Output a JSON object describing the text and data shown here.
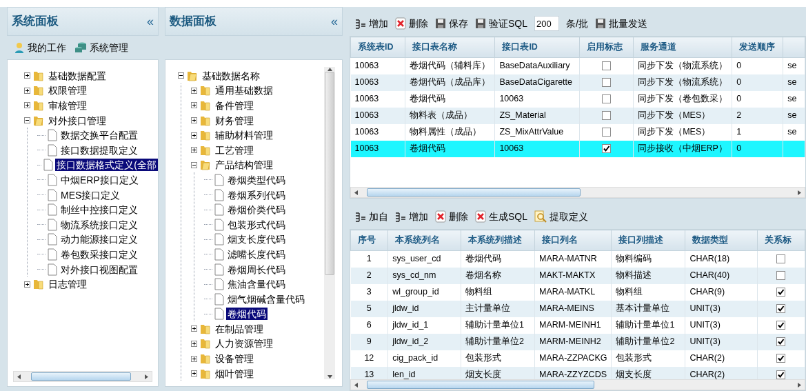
{
  "system_panel": {
    "title": "系统面板",
    "collapse": "«",
    "shortcuts": [
      {
        "label": "我的工作"
      },
      {
        "label": "系统管理"
      }
    ],
    "tree": [
      {
        "label": "基础数据配置",
        "kind": "folder",
        "expanded": false,
        "selected": false
      },
      {
        "label": "权限管理",
        "kind": "folder",
        "expanded": false,
        "selected": false
      },
      {
        "label": "审核管理",
        "kind": "folder",
        "expanded": false,
        "selected": false
      },
      {
        "label": "对外接口管理",
        "kind": "folder",
        "expanded": true,
        "selected": false,
        "children": [
          {
            "label": "数据交换平台配置",
            "kind": "leaf",
            "selected": false
          },
          {
            "label": "接口数据提取定义",
            "kind": "leaf",
            "selected": false
          },
          {
            "label": "接口数据格式定义(全部",
            "kind": "leaf",
            "selected": true
          },
          {
            "label": "中烟ERP接口定义",
            "kind": "leaf",
            "selected": false
          },
          {
            "label": "MES接口定义",
            "kind": "leaf",
            "selected": false
          },
          {
            "label": "制丝中控接口定义",
            "kind": "leaf",
            "selected": false
          },
          {
            "label": "物流系统接口定义",
            "kind": "leaf",
            "selected": false
          },
          {
            "label": "动力能源接口定义",
            "kind": "leaf",
            "selected": false
          },
          {
            "label": "卷包数采接口定义",
            "kind": "leaf",
            "selected": false
          },
          {
            "label": "对外接口视图配置",
            "kind": "leaf",
            "selected": false
          }
        ]
      },
      {
        "label": "日志管理",
        "kind": "folder",
        "expanded": false,
        "selected": false
      }
    ]
  },
  "data_panel": {
    "title": "数据面板",
    "collapse": "«",
    "tree": [
      {
        "label": "基础数据名称",
        "kind": "folder",
        "expanded": true,
        "selected": false,
        "children": [
          {
            "label": "通用基础数据",
            "kind": "folder",
            "expanded": false,
            "selected": false
          },
          {
            "label": "备件管理",
            "kind": "folder",
            "expanded": false,
            "selected": false
          },
          {
            "label": "财务管理",
            "kind": "folder",
            "expanded": false,
            "selected": false
          },
          {
            "label": "辅助材料管理",
            "kind": "folder",
            "expanded": false,
            "selected": false
          },
          {
            "label": "工艺管理",
            "kind": "folder",
            "expanded": false,
            "selected": false
          },
          {
            "label": "产品结构管理",
            "kind": "folder",
            "expanded": true,
            "selected": false,
            "children": [
              {
                "label": "卷烟类型代码",
                "kind": "leaf",
                "selected": false
              },
              {
                "label": "卷烟系列代码",
                "kind": "leaf",
                "selected": false
              },
              {
                "label": "卷烟价类代码",
                "kind": "leaf",
                "selected": false
              },
              {
                "label": "包装形式代码",
                "kind": "leaf",
                "selected": false
              },
              {
                "label": "烟支长度代码",
                "kind": "leaf",
                "selected": false
              },
              {
                "label": "滤嘴长度代码",
                "kind": "leaf",
                "selected": false
              },
              {
                "label": "卷烟周长代码",
                "kind": "leaf",
                "selected": false
              },
              {
                "label": "焦油含量代码",
                "kind": "leaf",
                "selected": false
              },
              {
                "label": "烟气烟碱含量代码",
                "kind": "leaf",
                "selected": false
              },
              {
                "label": "卷烟代码",
                "kind": "leaf",
                "selected": true
              }
            ]
          },
          {
            "label": "在制品管理",
            "kind": "folder",
            "expanded": false,
            "selected": false
          },
          {
            "label": "人力资源管理",
            "kind": "folder",
            "expanded": false,
            "selected": false
          },
          {
            "label": "设备管理",
            "kind": "folder",
            "expanded": false,
            "selected": false
          },
          {
            "label": "烟叶管理",
            "kind": "folder",
            "expanded": false,
            "selected": false
          }
        ]
      }
    ]
  },
  "interface_toolbar": [
    {
      "kind": "button",
      "label": "增加"
    },
    {
      "kind": "button",
      "label": "删除"
    },
    {
      "kind": "button",
      "label": "保存"
    },
    {
      "kind": "button",
      "label": "验证SQL"
    },
    {
      "kind": "input",
      "value": "200"
    },
    {
      "kind": "text",
      "label": "条/批"
    },
    {
      "kind": "button",
      "label": "批量发送"
    }
  ],
  "interface_table": {
    "columns": [
      {
        "label": "系统表ID",
        "kind": "text"
      },
      {
        "label": "接口表名称",
        "kind": "text"
      },
      {
        "label": "接口表ID",
        "kind": "text"
      },
      {
        "label": "启用标志",
        "kind": "check"
      },
      {
        "label": "服务通道",
        "kind": "text"
      },
      {
        "label": "发送顺序",
        "kind": "text"
      },
      {
        "kind": "text"
      }
    ],
    "rows": [
      {
        "selected": false,
        "cells": [
          "10063",
          "卷烟代码（辅料库）",
          "BaseDataAuxiliary",
          false,
          "同步下发（物流系统）",
          "0",
          "se"
        ]
      },
      {
        "selected": false,
        "cells": [
          "10063",
          "卷烟代码（成品库）",
          "BaseDataCigarette",
          false,
          "同步下发（物流系统）",
          "0",
          "se"
        ]
      },
      {
        "selected": false,
        "cells": [
          "10063",
          "卷烟代码",
          "10063",
          false,
          "同步下发（卷包数采）",
          "0",
          "se"
        ]
      },
      {
        "selected": false,
        "cells": [
          "10063",
          "物料表（成品）",
          "ZS_Material",
          false,
          "同步下发（MES）",
          "2",
          "se"
        ]
      },
      {
        "selected": false,
        "cells": [
          "10063",
          "物料属性（成品）",
          "ZS_MixAttrValue",
          false,
          "同步下发（MES）",
          "1",
          "se"
        ]
      },
      {
        "selected": true,
        "cells": [
          "10063",
          "卷烟代码",
          "10063",
          true,
          "同步接收（中烟ERP）",
          "0",
          ""
        ]
      }
    ]
  },
  "column_toolbar": [
    {
      "kind": "button",
      "label": "加自"
    },
    {
      "kind": "button",
      "label": "增加"
    },
    {
      "kind": "button",
      "label": "删除"
    },
    {
      "kind": "button",
      "label": "生成SQL"
    },
    {
      "kind": "button",
      "label": "提取定义"
    }
  ],
  "column_table": {
    "columns": [
      {
        "label": "序号",
        "kind": "center"
      },
      {
        "label": "本系统列名",
        "kind": "text"
      },
      {
        "label": "本系统列描述",
        "kind": "text"
      },
      {
        "label": "接口列名",
        "kind": "text"
      },
      {
        "label": "接口列描述",
        "kind": "text"
      },
      {
        "label": "数据类型",
        "kind": "text"
      },
      {
        "label": "关系标",
        "kind": "check"
      }
    ],
    "rows": [
      {
        "selected": false,
        "cells": [
          "1",
          "sys_user_cd",
          "卷烟代码",
          "MARA-MATNR",
          "物料编码",
          "CHAR(18)",
          false
        ]
      },
      {
        "selected": false,
        "cells": [
          "2",
          "sys_cd_nm",
          "卷烟名称",
          "MAKT-MAKTX",
          "物料描述",
          "CHAR(40)",
          false
        ]
      },
      {
        "selected": false,
        "cells": [
          "3",
          "wl_group_id",
          "物料组",
          "MARA-MATKL",
          "物料组",
          "CHAR(9)",
          true
        ]
      },
      {
        "selected": false,
        "cells": [
          "5",
          "jldw_id",
          "主计量单位",
          "MARA-MEINS",
          "基本计量单位",
          "UNIT(3)",
          true
        ]
      },
      {
        "selected": false,
        "cells": [
          "6",
          "jldw_id_1",
          "辅助计量单位1",
          "MARM-MEINH1",
          "辅助计量单位1",
          "UNIT(3)",
          true
        ]
      },
      {
        "selected": false,
        "cells": [
          "9",
          "jldw_id_2",
          "辅助计量单位2",
          "MARM-MEINH2",
          "辅助计量单位2",
          "UNIT(3)",
          true
        ]
      },
      {
        "selected": false,
        "cells": [
          "12",
          "cig_pack_id",
          "包装形式",
          "MARA-ZZPACKG",
          "包装形式",
          "CHAR(2)",
          true
        ]
      },
      {
        "selected": false,
        "cells": [
          "13",
          "len_id",
          "烟支长度",
          "MARA-ZZYZCDS",
          "烟支长度",
          "CHAR(2)",
          true
        ]
      }
    ]
  }
}
